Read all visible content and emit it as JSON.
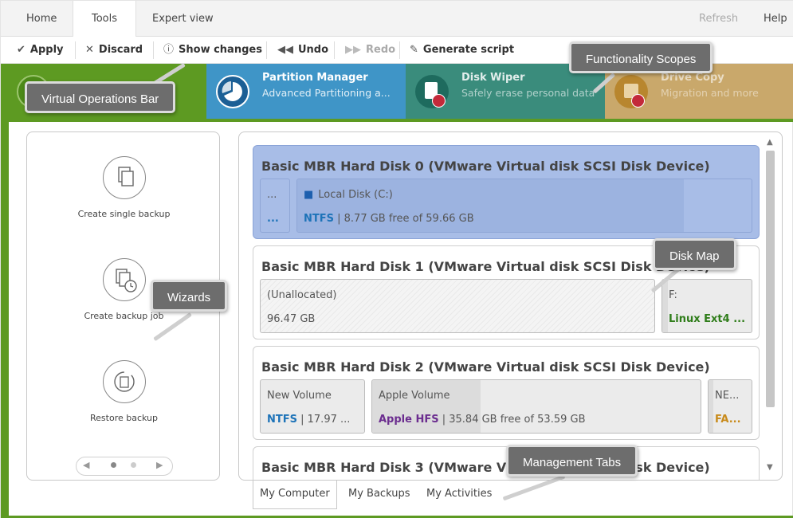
{
  "menu": {
    "tabs": [
      "Home",
      "Tools",
      "Expert view"
    ],
    "refresh": "Refresh",
    "help": "Help"
  },
  "toolbar": {
    "apply": "Apply",
    "discard": "Discard",
    "show_changes": "Show changes",
    "undo": "Undo",
    "redo": "Redo",
    "generate_script": "Generate script"
  },
  "scopes": [
    {
      "title": "Partition Manager",
      "subtitle": "Advanced Partitioning a...",
      "color": "#3f95c7"
    },
    {
      "title": "Disk Wiper",
      "subtitle": "Safely erase personal data",
      "color": "#3a8c7c"
    },
    {
      "title": "Drive Copy",
      "subtitle": "Migration and more",
      "color": "#b8862e"
    }
  ],
  "wizards": [
    {
      "label": "Create single backup",
      "icon": "copy-pages-icon"
    },
    {
      "label": "Create backup job",
      "icon": "scheduled-backup-icon"
    },
    {
      "label": "Restore backup",
      "icon": "restore-icon"
    }
  ],
  "disks": [
    {
      "title": "Basic MBR Hard Disk 0 (VMware Virtual disk SCSI Disk Device)",
      "partitions": [
        {
          "name": "...",
          "info": "..."
        },
        {
          "name": "Local Disk (C:)",
          "fs": "NTFS",
          "info": " | 8.77 GB free of 59.66 GB"
        }
      ]
    },
    {
      "title": "Basic MBR Hard Disk 1 (VMware Virtual disk SCSI Disk Device)",
      "partitions": [
        {
          "name": "(Unallocated)",
          "info": "96.47 GB"
        },
        {
          "name": "F:",
          "fs": "Linux Ext4 ..."
        }
      ]
    },
    {
      "title": "Basic MBR Hard Disk 2 (VMware Virtual disk SCSI Disk Device)",
      "partitions": [
        {
          "name": "New Volume",
          "fs": "NTFS",
          "info": " | 17.97 ..."
        },
        {
          "name": "Apple Volume",
          "fs": "Apple HFS",
          "info": " | 35.84 GB free of 53.59 GB"
        },
        {
          "name": "NE...",
          "fs": "FA..."
        }
      ]
    },
    {
      "title": "Basic MBR Hard Disk 3 (VMware Virtual disk SCSI Disk Device)"
    }
  ],
  "management_tabs": [
    "My Computer",
    "My Backups",
    "My Activities"
  ],
  "callouts": {
    "virtual_operations_bar": "Virtual Operations Bar",
    "functionality_scopes": "Functionality Scopes",
    "wizards": "Wizards",
    "disk_map": "Disk Map",
    "management_tabs": "Management Tabs"
  },
  "colors": {
    "accent_green": "#5d9a22",
    "selected_disk": "#a8bde7",
    "ntfs_blue": "#1d73b8",
    "linux_green": "#2f7d1a",
    "apple_purple": "#6b2d8f",
    "fat_orange": "#c88a1a",
    "lock_red": "#c32a3a"
  }
}
